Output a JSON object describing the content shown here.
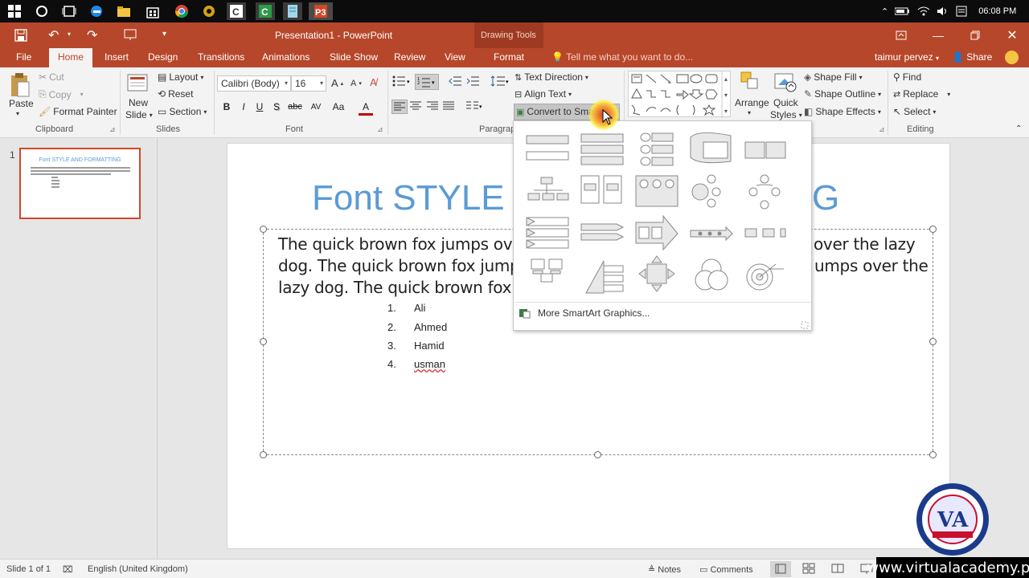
{
  "taskbar": {
    "clock": "06:08 PM",
    "pinned_icons": [
      "start-icon",
      "cortana-icon",
      "task-view-icon",
      "edge-icon",
      "file-explorer-icon",
      "store-icon",
      "chrome-icon",
      "app-icon",
      "camtasia-icon",
      "camtasia-green-icon",
      "notepad-icon",
      "powerpoint-icon"
    ]
  },
  "titlebar": {
    "title": "Presentation1 - PowerPoint",
    "context_group": "Drawing Tools"
  },
  "tabs": {
    "file": "File",
    "home": "Home",
    "insert": "Insert",
    "design": "Design",
    "transitions": "Transitions",
    "animations": "Animations",
    "slideshow": "Slide Show",
    "review": "Review",
    "view": "View",
    "format": "Format",
    "tellme": "Tell me what you want to do...",
    "user": "taimur pervez",
    "share": "Share"
  },
  "ribbon": {
    "clipboard": {
      "paste": "Paste",
      "cut": "Cut",
      "copy": "Copy",
      "format_painter": "Format Painter",
      "label": "Clipboard"
    },
    "slides": {
      "new_slide_line1": "New",
      "new_slide_line2": "Slide",
      "layout": "Layout",
      "reset": "Reset",
      "section": "Section",
      "label": "Slides"
    },
    "font": {
      "font_name": "Calibri (Body)",
      "font_size": "16",
      "label": "Font",
      "buttons": [
        "B",
        "I",
        "U",
        "S",
        "abc",
        "AV",
        "Aa",
        "A"
      ]
    },
    "paragraph": {
      "text_direction": "Text Direction",
      "align_text": "Align Text",
      "convert_smartart": "Convert to SmartArt",
      "label": "Paragraph"
    },
    "drawing": {
      "arrange": "Arrange",
      "quick_styles_line1": "Quick",
      "quick_styles_line2": "Styles",
      "shape_fill": "Shape Fill",
      "shape_outline": "Shape Outline",
      "shape_effects": "Shape Effects"
    },
    "editing": {
      "find": "Find",
      "replace": "Replace",
      "select": "Select",
      "label": "Editing"
    }
  },
  "slide_panel": {
    "slide_number": "1",
    "thumb_title": "Font STYLE AND FORMATTING"
  },
  "slide": {
    "title_left": "Font STYLE",
    "title_right": "G",
    "body_lines": [
      {
        "left": "The quick brown fox jumps over",
        "right": "over the lazy"
      },
      {
        "left": "dog. The quick brown fox jumps",
        "right": "umps over the"
      },
      {
        "left": "lazy dog. The quick brown fox ju",
        "right": ""
      }
    ],
    "list": [
      {
        "num": "1.",
        "text": "Ali"
      },
      {
        "num": "2.",
        "text": "Ahmed"
      },
      {
        "num": "3.",
        "text": "Hamid"
      },
      {
        "num": "4.",
        "text": "usman"
      }
    ]
  },
  "smartart_gallery": {
    "more": "More SmartArt Graphics...",
    "layouts": [
      "vertical-bullet-list",
      "vertical-box-list",
      "vertical-bracket-list",
      "trapezoid-list",
      "horizontal-bullet-list",
      "hierarchy",
      "table-list",
      "picture-list",
      "radial-cluster",
      "basic-cycle",
      "vertical-chevron-list",
      "stacked-list",
      "process-arrows",
      "basic-timeline",
      "basic-process",
      "picture-organization",
      "pyramid-list",
      "cross-arrows",
      "basic-venn",
      "target-list"
    ]
  },
  "statusbar": {
    "slide_count": "Slide 1 of 1",
    "language": "English (United Kingdom)",
    "notes": "Notes",
    "comments": "Comments"
  },
  "watermark": {
    "url": "www.virtualacademy.pk"
  }
}
